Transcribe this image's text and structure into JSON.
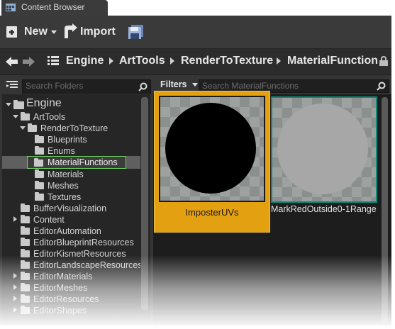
{
  "tab": {
    "title": "Content Browser"
  },
  "toolbar": {
    "new_label": "New",
    "import_label": "Import"
  },
  "breadcrumb": [
    "Engine",
    "ArtTools",
    "RenderToTexture",
    "MaterialFunctions"
  ],
  "folders_search": {
    "placeholder": "Search Folders"
  },
  "asset_filter": {
    "filters_label": "Filters",
    "search_placeholder": "Search MaterialFunctions"
  },
  "tree": {
    "root": "Engine",
    "items": [
      "ArtTools",
      "RenderToTexture",
      "Blueprints",
      "Enums",
      "MaterialFunctions",
      "Materials",
      "Meshes",
      "Textures",
      "BufferVisualization",
      "Content",
      "EditorAutomation",
      "EditorBlueprintResources",
      "EditorKismetResources",
      "EditorLandscapeResources",
      "EditorMaterials",
      "EditorMeshes",
      "EditorResources",
      "EditorShapes"
    ]
  },
  "assets": [
    {
      "name": "ImposterUVs",
      "selected": true
    },
    {
      "name": "MarkRedOutside0-1Range",
      "selected": false
    }
  ],
  "colors": {
    "selection": "#e3a112",
    "highlight": "#6bd860",
    "tile_accent": "#0e8a78"
  }
}
